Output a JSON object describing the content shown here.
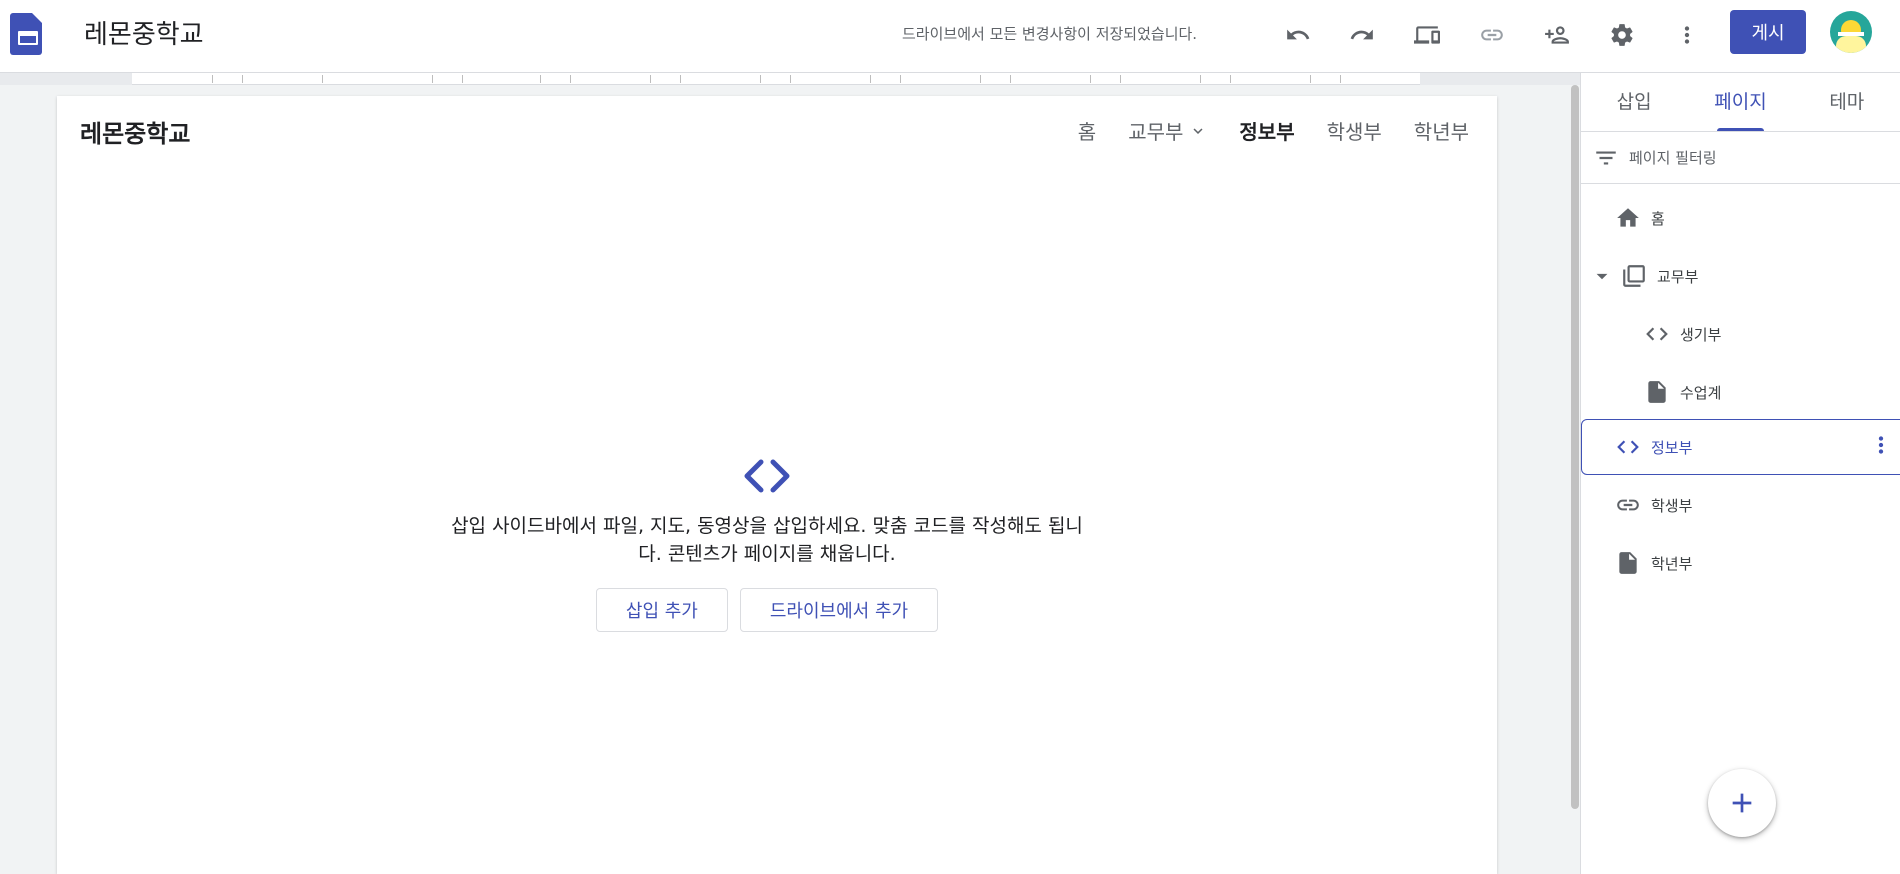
{
  "app": {
    "site_title": "레몬중학교",
    "save_status": "드라이브에서 모든 변경사항이 저장되었습니다.",
    "publish_label": "게시",
    "icons": [
      "undo-icon",
      "redo-icon",
      "device-preview-icon",
      "link-icon",
      "add-person-icon",
      "gear-icon",
      "more-vert-icon"
    ]
  },
  "site": {
    "brand": "레몬중학교",
    "nav": [
      {
        "label": "홈",
        "active": false
      },
      {
        "label": "교무부",
        "dropdown": true,
        "active": false
      },
      {
        "label": "정보부",
        "active": true
      },
      {
        "label": "학생부",
        "active": false
      },
      {
        "label": "학년부",
        "active": false
      }
    ],
    "embed": {
      "message": "삽입 사이드바에서 파일, 지도, 동영상을 삽입하세요. 맞춤 코드를 작성해도 됩니 다. 콘텐츠가 페이지를 채웁니다.",
      "line1": "삽입 사이드바에서 파일, 지도, 동영상을 삽입하세요. 맞춤 코드를 작성해도 됩니",
      "line2": "다. 콘텐츠가 페이지를 채웁니다.",
      "buttons": [
        "삽입 추가",
        "드라이브에서 추가"
      ]
    }
  },
  "panel": {
    "tabs": [
      {
        "label": "삽입",
        "active": false
      },
      {
        "label": "페이지",
        "active": true
      },
      {
        "label": "테마",
        "active": false
      }
    ],
    "filter_placeholder": "페이지 필터링",
    "pages": [
      {
        "label": "홈",
        "icon": "home-icon",
        "level": 0
      },
      {
        "label": "교무부",
        "icon": "pages-icon",
        "level": 0,
        "expanded": true
      },
      {
        "label": "생기부",
        "icon": "code-icon",
        "level": 1
      },
      {
        "label": "수업계",
        "icon": "file-icon",
        "level": 1
      },
      {
        "label": "정보부",
        "icon": "code-icon",
        "level": 0,
        "selected": true
      },
      {
        "label": "학생부",
        "icon": "link-icon",
        "level": 0
      },
      {
        "label": "학년부",
        "icon": "file-icon",
        "level": 0
      }
    ]
  },
  "colors": {
    "accent": "#3f51b5",
    "text": "#202124",
    "muted": "#5f6368",
    "border": "#dadce0"
  }
}
